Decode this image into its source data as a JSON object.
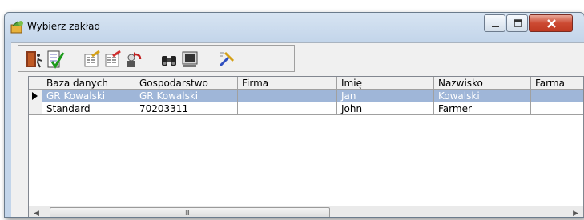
{
  "window": {
    "title": "Wybierz zakład"
  },
  "toolbar": {
    "buttons": [
      {
        "icon": "exit-door-icon"
      },
      {
        "icon": "checklist-icon"
      },
      {
        "icon": "edit-list-icon"
      },
      {
        "icon": "edit-list-2-icon"
      },
      {
        "icon": "undo-icon"
      },
      {
        "icon": "binoculars-icon"
      },
      {
        "icon": "monitor-icon"
      },
      {
        "icon": "tools-icon"
      }
    ]
  },
  "grid": {
    "columns": [
      "Baza danych",
      "Gospodarstwo",
      "Firma",
      "Imię",
      "Nazwisko",
      "Farma"
    ],
    "rows": [
      {
        "selected": true,
        "cells": [
          "GR Kowalski",
          "GR Kowalski",
          "",
          "Jan",
          "Kowalski",
          ""
        ]
      },
      {
        "selected": false,
        "cells": [
          "Standard",
          "70203311",
          "",
          "John",
          "Farmer",
          ""
        ]
      }
    ],
    "scroll_grip": "III"
  },
  "colors": {
    "selection": "#9fb6d8",
    "close_button": "#cc4a32"
  }
}
